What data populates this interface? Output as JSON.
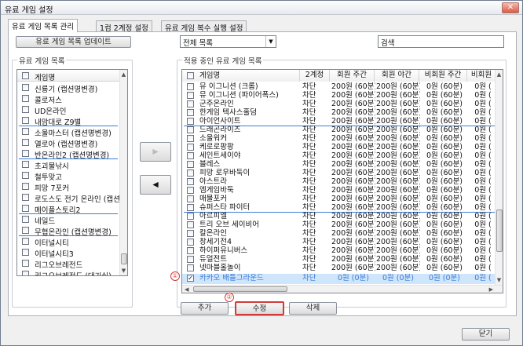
{
  "window": {
    "title": "유료 게임 설정",
    "close_glyph": "✕"
  },
  "tabs": [
    {
      "label": "유료 게임 목록 관리",
      "active": true
    },
    {
      "label": "1컴 2계정 설정",
      "active": false
    },
    {
      "label": "유료 게임 복수 실행 설정",
      "active": false
    }
  ],
  "toolbar": {
    "update_button": "유료 게임 목록 업데이트",
    "filter_value": "전체 목록",
    "search_value": "검색"
  },
  "left_group": {
    "title": "유료 게임 목록",
    "header": "게임명",
    "items": [
      "신룡기 (캡션명변경)",
      "콜로저스",
      "UD온라인",
      "내맘대로 Z9별",
      "소울마스터 (캡션명변경)",
      "열로아 (캡션명변경)",
      "반온라인2 (캡션명변경)",
      "초괴물낚시",
      "철투맞고",
      "피망 7포커",
      "로도스도 전기 온라인 (캡션명",
      "메이플스토리2",
      "네일드",
      "무협온라인 (캡션명변경)",
      "이터널시티",
      "이터널시티3",
      "리그오브레전드",
      "리그오브레전드 (대기실)"
    ],
    "separators_after": [
      3,
      6,
      11,
      13
    ]
  },
  "arrows": {
    "right": "▶",
    "left": "◀"
  },
  "right_group": {
    "title": "적용 중인 유료 게임 목록",
    "columns": [
      "게임명",
      "2계정",
      "회원 주간",
      "회원 야간",
      "비회원 주간",
      "비회원"
    ],
    "rows": [
      [
        "뮤 이그니션 (크롬)",
        "차단",
        "200원 (60분)",
        "200원 (60분)",
        "0원 (60분)",
        "0원 ("
      ],
      [
        "뮤 이그니션 (파이어폭스)",
        "차단",
        "200원 (60분)",
        "200원 (60분)",
        "0원 (60분)",
        "0원 ("
      ],
      [
        "군주온라인",
        "차단",
        "200원 (60분)",
        "200원 (60분)",
        "0원 (60분)",
        "0원 ("
      ],
      [
        "한게임 텍사스홀덤",
        "차단",
        "200원 (60분)",
        "200원 (60분)",
        "0원 (60분)",
        "0원 ("
      ],
      [
        "아이언사이트",
        "차단",
        "200원 (60분)",
        "200원 (60분)",
        "0원 (60분)",
        "0원 ("
      ],
      [
        "드래곤라이즈",
        "차단",
        "200원 (60분)",
        "200원 (60분)",
        "0원 (60분)",
        "0원 ("
      ],
      [
        "소울워커",
        "차단",
        "200원 (60분)",
        "200원 (60분)",
        "0원 (60분)",
        "0원 ("
      ],
      [
        "케로로팡팡",
        "차단",
        "200원 (60분)",
        "200원 (60분)",
        "0원 (60분)",
        "0원 ("
      ],
      [
        "세인트세이야",
        "차단",
        "200원 (60분)",
        "200원 (60분)",
        "0원 (60분)",
        "0원 ("
      ],
      [
        "블레스",
        "차단",
        "200원 (60분)",
        "200원 (60분)",
        "0원 (60분)",
        "0원 ("
      ],
      [
        "피망 로우바둑이",
        "차단",
        "200원 (60분)",
        "200원 (60분)",
        "0원 (60분)",
        "0원 ("
      ],
      [
        "아스트라",
        "차단",
        "200원 (60분)",
        "200원 (60분)",
        "0원 (60분)",
        "0원 ("
      ],
      [
        "엠게임바둑",
        "차단",
        "200원 (60분)",
        "200원 (60분)",
        "0원 (60분)",
        "0원 ("
      ],
      [
        "매물포커",
        "차단",
        "200원 (60분)",
        "200원 (60분)",
        "0원 (60분)",
        "0원 ("
      ],
      [
        "슈퍼스타 파이터",
        "차단",
        "200원 (60분)",
        "200원 (60분)",
        "0원 (60분)",
        "0원 ("
      ],
      [
        "아르피엘",
        "차단",
        "200원 (60분)",
        "200원 (60분)",
        "0원 (60분)",
        "0원 ("
      ],
      [
        "트리 오브 세이비어",
        "차단",
        "200원 (60분)",
        "200원 (60분)",
        "0원 (60분)",
        "0원 ("
      ],
      [
        "칼온라인",
        "차단",
        "200원 (60분)",
        "200원 (60분)",
        "0원 (60분)",
        "0원 ("
      ],
      [
        "창세기전4",
        "차단",
        "200원 (60분)",
        "200원 (60분)",
        "0원 (60분)",
        "0원 ("
      ],
      [
        "하이퍼유니버스",
        "차단",
        "200원 (60분)",
        "200원 (60분)",
        "0원 (60분)",
        "0원 ("
      ],
      [
        "듀얼전트",
        "차단",
        "200원 (60분)",
        "200원 (60분)",
        "0원 (60분)",
        "0원 ("
      ],
      [
        "넷마블홀놀이",
        "차단",
        "200원 (60분)",
        "200원 (60분)",
        "0원 (60분)",
        "0원 ("
      ],
      [
        "카카오 배틀그라운드",
        "차단",
        "0원 (0분)",
        "0원 (0분)",
        "0원 (0분)",
        "0원 ("
      ]
    ],
    "selected_row": 22,
    "separators_after": [
      4,
      14
    ]
  },
  "actions": {
    "add": "추가",
    "edit": "수정",
    "delete": "삭제"
  },
  "markers": {
    "row_marker": "①",
    "edit_marker": "②"
  },
  "footer": {
    "close": "닫기"
  },
  "colors": {
    "accent": "#3b7bd6",
    "selected_bg": "#cfe5fb",
    "marker": "#d23a3a"
  }
}
